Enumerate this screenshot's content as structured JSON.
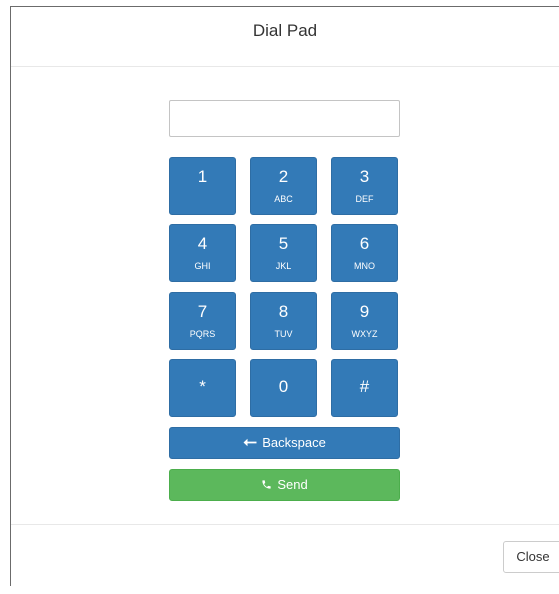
{
  "dialog": {
    "title": "Dial Pad",
    "input_value": "",
    "input_placeholder": ""
  },
  "keypad": {
    "keys": [
      {
        "digit": "1",
        "letters": ""
      },
      {
        "digit": "2",
        "letters": "ABC"
      },
      {
        "digit": "3",
        "letters": "DEF"
      },
      {
        "digit": "4",
        "letters": "GHI"
      },
      {
        "digit": "5",
        "letters": "JKL"
      },
      {
        "digit": "6",
        "letters": "MNO"
      },
      {
        "digit": "7",
        "letters": "PQRS"
      },
      {
        "digit": "8",
        "letters": "TUV"
      },
      {
        "digit": "9",
        "letters": "WXYZ"
      },
      {
        "digit": "*",
        "letters": ""
      },
      {
        "digit": "0",
        "letters": ""
      },
      {
        "digit": "#",
        "letters": ""
      }
    ]
  },
  "actions": {
    "backspace_label": "Backspace",
    "backspace_icon": "arrow-left-icon",
    "send_label": "Send",
    "send_icon": "phone-icon"
  },
  "footer": {
    "close_label": "Close"
  },
  "colors": {
    "primary": "#337ab7",
    "success": "#5cb85c"
  }
}
